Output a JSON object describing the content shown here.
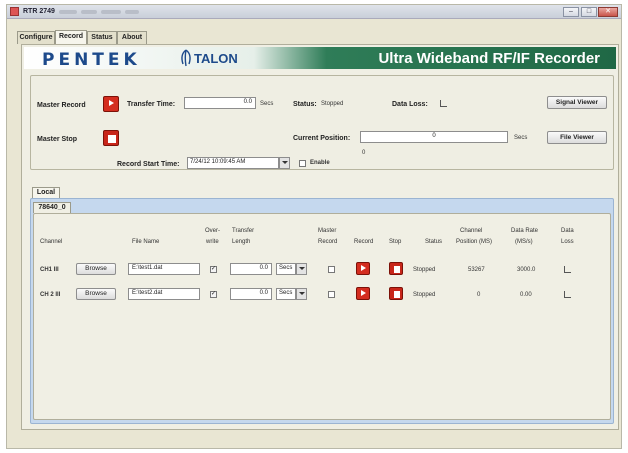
{
  "window": {
    "title": "RTR 2749"
  },
  "tabs": [
    "Configure",
    "Record",
    "Status",
    "About"
  ],
  "banner": {
    "logo": "PENTEK",
    "sublogo": "TALON",
    "title": "Ultra Wideband RF/IF Recorder"
  },
  "master": {
    "record_label": "Master Record",
    "stop_label": "Master Stop",
    "transfer_time_label": "Transfer Time:",
    "transfer_time_value": "0.0",
    "transfer_time_unit": "Secs",
    "status_label": "Status:",
    "status_value": "Stopped",
    "data_loss_label": "Data Loss:",
    "signal_viewer_button": "Signal Viewer",
    "current_position_label": "Current Position:",
    "current_position_value": "0",
    "current_position_unit": "Secs",
    "position_min": "0",
    "file_viewer_button": "File Viewer",
    "record_start_time_label": "Record Start Time:",
    "record_start_time_value": "7/24/12 10:09:45 AM",
    "enable_label": "Enable"
  },
  "local_tab": "Local",
  "board_tab": "78640_0",
  "columns": {
    "channel": "Channel",
    "file_name": "File Name",
    "overwrite_1": "Over-",
    "overwrite_2": "write",
    "transfer_1": "Transfer",
    "transfer_2": "Length",
    "master_1": "Master",
    "master_2": "Record",
    "record": "Record",
    "stop": "Stop",
    "status": "Status",
    "position_1": "Channel",
    "position_2": "Position (MS)",
    "rate_1": "Data Rate",
    "rate_2": "(MS/s)",
    "loss_1": "Data",
    "loss_2": "Loss"
  },
  "rows": [
    {
      "channel": "CH1 III",
      "browse": "Browse",
      "file_name": "E:\\test1.dat",
      "overwrite": true,
      "transfer_length": "0.0",
      "unit": "Secs",
      "master_record": false,
      "status": "Stopped",
      "position": "53267",
      "rate": "3000.0"
    },
    {
      "channel": "CH 2 III",
      "browse": "Browse",
      "file_name": "E:\\test2.dat",
      "overwrite": true,
      "transfer_length": "0.0",
      "unit": "Secs",
      "master_record": false,
      "status": "Stopped",
      "position": "0",
      "rate": "0.00"
    }
  ],
  "colors": {
    "brand_green": "#1f6845",
    "brand_blue": "#1d4a8b",
    "record_red": "#d42d1f",
    "panel_blue": "#c5d8ee"
  }
}
